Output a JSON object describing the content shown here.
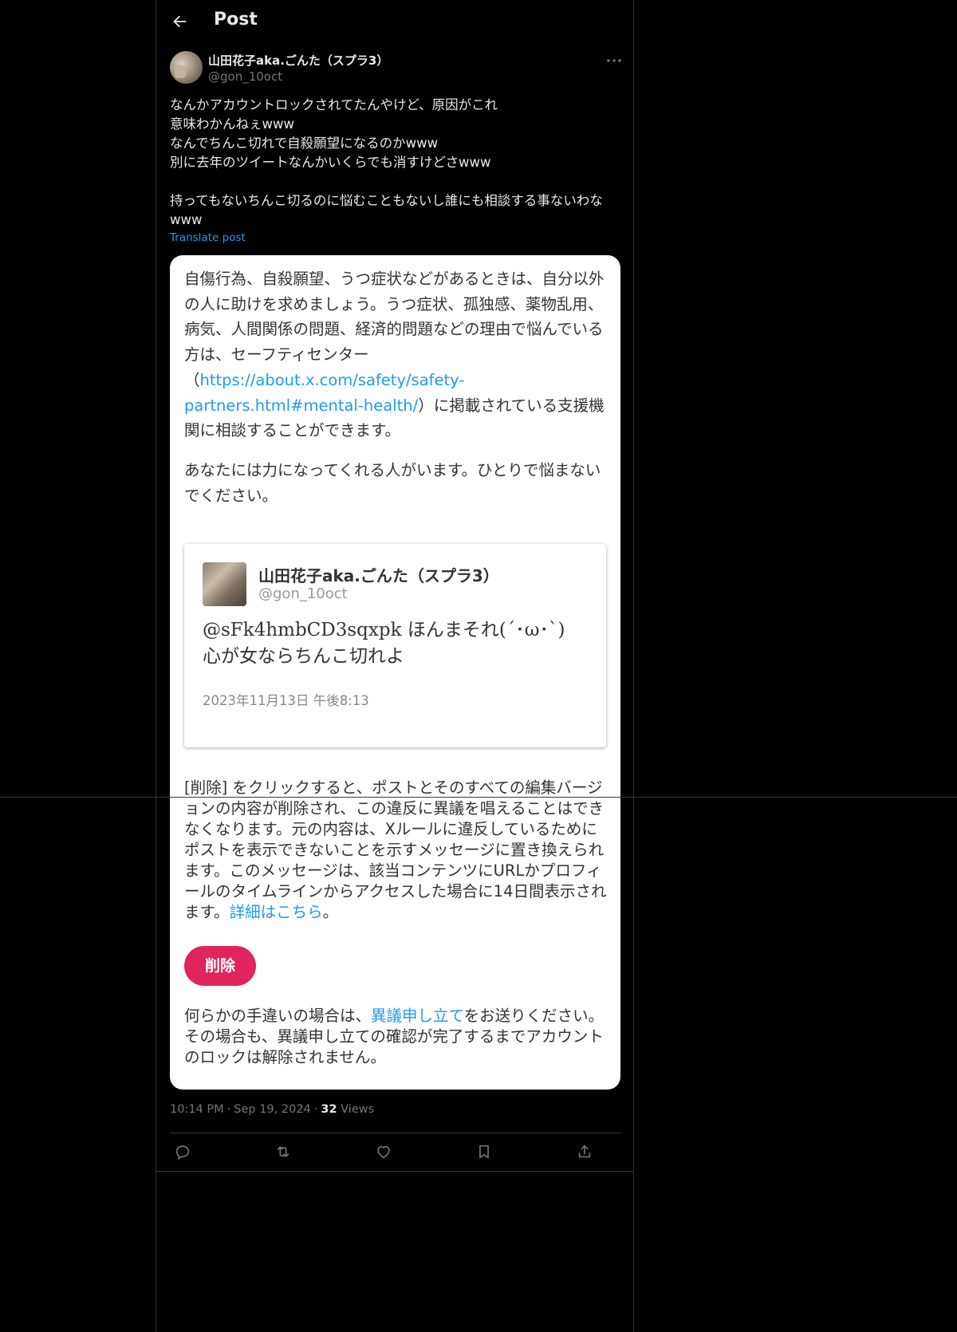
{
  "header": {
    "title": "Post"
  },
  "author": {
    "name": "山田花子aka.ごんた（スプラ3）",
    "handle": "@gon_10oct"
  },
  "post": {
    "lines": [
      "なんかアカウントロックされてたんやけど、原因がこれ",
      "意味わかんねぇwww",
      "なんでちんこ切れで自殺願望になるのかwww",
      "別に去年のツイートなんかいくらでも消すけどさwww"
    ],
    "line5": "持ってもないちんこ切るのに悩むこともないし誰にも相談する事ないわなwww",
    "translate_label": "Translate post"
  },
  "card": {
    "para1_before": "自傷行為、自殺願望、うつ症状などがあるときは、自分以外の人に助けを求めましょう。うつ症状、孤独感、薬物乱用、病気、人間関係の問題、経済的問題などの理由で悩んでいる方は、セーフティセンター（",
    "para1_link": "https://about.x.com/safety/safety-partners.html#mental-health/",
    "para1_after": "）に掲載されている支援機関に相談することができます。",
    "para2": "あなたには力になってくれる人がいます。ひとりで悩まないでください。",
    "embed": {
      "name": "山田花子aka.ごんた（スプラ3）",
      "handle": "@gon_10oct",
      "text": "@sFk4hmbCD3sqxpk ほんまそれ(´･ω･`) 心が女ならちんこ切れよ",
      "date": "2023年11月13日 午後8:13"
    },
    "para3_before": "[削除] をクリックすると、ポストとそのすべての編集バージョンの内容が削除され、この違反に異議を唱えることはできなくなります。元の内容は、Xルールに違反しているためにポストを表示できないことを示すメッセージに置き換えられます。このメッセージは、該当コンテンツにURLかプロフィールのタイムラインからアクセスした場合に14日間表示されます。",
    "para3_link": "詳細はこちら",
    "para3_after": "。",
    "delete_label": "削除",
    "para4_before": "何らかの手違いの場合は、",
    "para4_link": "異議申し立て",
    "para4_after": "をお送りください。その場合も、異議申し立ての確認が完了するまでアカウントのロックは解除されません。"
  },
  "meta": {
    "time": "10:14 PM",
    "date": "Sep 19, 2024",
    "separator": "·",
    "views_count": "32",
    "views_label": "Views"
  },
  "icons": {
    "back": "back-arrow-icon",
    "more": "more-icon",
    "reply": "reply-icon",
    "repost": "repost-icon",
    "like": "like-icon",
    "bookmark": "bookmark-icon",
    "share": "share-icon"
  },
  "colors": {
    "accent": "#1d9bf0",
    "delete_button": "#e0245e",
    "background": "#000000",
    "card": "#ffffff"
  }
}
